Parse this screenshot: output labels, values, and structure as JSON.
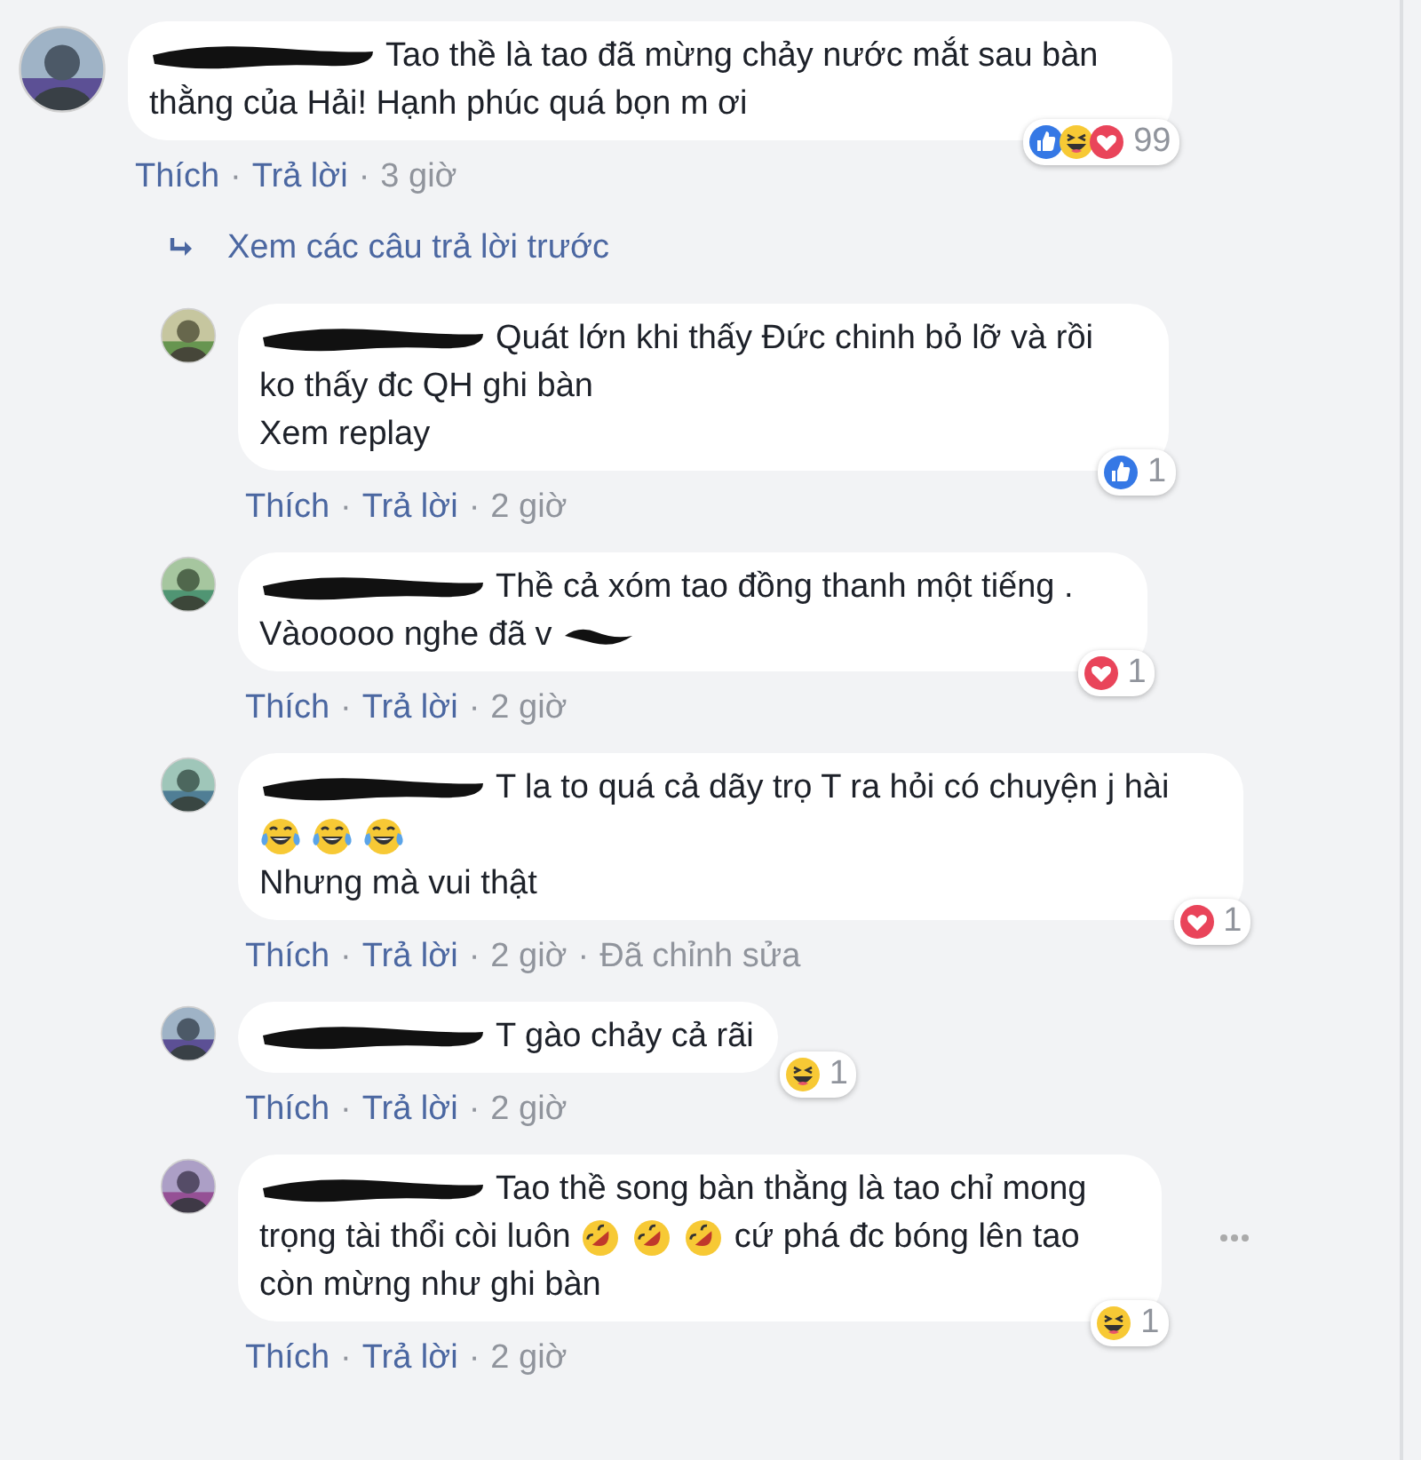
{
  "comment": {
    "lines": [
      [
        {
          "kind": "redaction"
        },
        {
          "kind": "text",
          "text": "Tao thề là tao đã mừng chảy nước mắt sau bàn"
        }
      ],
      [
        {
          "kind": "text",
          "text": "thằng của Hải! Hạnh phúc quá bọn m ơi"
        }
      ]
    ],
    "meta": [
      {
        "kind": "link",
        "text": "Thích"
      },
      {
        "kind": "dot",
        "text": "·"
      },
      {
        "kind": "link",
        "text": "Trả lời"
      },
      {
        "kind": "dot",
        "text": "·"
      },
      {
        "kind": "time",
        "text": "3 giờ"
      }
    ],
    "reactions": {
      "icons": [
        {
          "kind": "like"
        },
        {
          "kind": "haha"
        },
        {
          "kind": "love"
        }
      ],
      "count": "99"
    }
  },
  "view_previous": {
    "text": "Xem các câu trả lời trước"
  },
  "replies": [
    {
      "lines": [
        [
          {
            "kind": "redaction"
          },
          {
            "kind": "text",
            "text": "Quát lớn khi thấy Đức chinh bỏ lỡ và rồi"
          }
        ],
        [
          {
            "kind": "text",
            "text": "ko thấy đc QH ghi bàn"
          }
        ],
        [
          {
            "kind": "text",
            "text": "Xem replay"
          }
        ]
      ],
      "meta": [
        {
          "kind": "link",
          "text": "Thích"
        },
        {
          "kind": "dot",
          "text": "·"
        },
        {
          "kind": "link",
          "text": "Trả lời"
        },
        {
          "kind": "dot",
          "text": "·"
        },
        {
          "kind": "time",
          "text": "2 giờ"
        }
      ],
      "reactions": {
        "icons": [
          {
            "kind": "like"
          }
        ],
        "count": "1"
      }
    },
    {
      "lines": [
        [
          {
            "kind": "redaction"
          },
          {
            "kind": "text",
            "text": "Thề cả xóm tao đồng thanh một tiếng ."
          }
        ],
        [
          {
            "kind": "text",
            "text": "Vàooooo nghe đã v"
          },
          {
            "kind": "redaction-short"
          }
        ]
      ],
      "meta": [
        {
          "kind": "link",
          "text": "Thích"
        },
        {
          "kind": "dot",
          "text": "·"
        },
        {
          "kind": "link",
          "text": "Trả lời"
        },
        {
          "kind": "dot",
          "text": "·"
        },
        {
          "kind": "time",
          "text": "2 giờ"
        }
      ],
      "reactions": {
        "icons": [
          {
            "kind": "love"
          }
        ],
        "count": "1"
      }
    },
    {
      "lines": [
        [
          {
            "kind": "redaction"
          },
          {
            "kind": "text",
            "text": "T la to quá cả dãy trọ T ra hỏi có chuyện j hài"
          }
        ],
        [
          {
            "kind": "joy"
          },
          {
            "kind": "joy"
          },
          {
            "kind": "joy"
          }
        ],
        [
          {
            "kind": "text",
            "text": "Nhưng mà vui thật"
          }
        ]
      ],
      "meta": [
        {
          "kind": "link",
          "text": "Thích"
        },
        {
          "kind": "dot",
          "text": "·"
        },
        {
          "kind": "link",
          "text": "Trả lời"
        },
        {
          "kind": "dot",
          "text": "·"
        },
        {
          "kind": "time",
          "text": "2 giờ"
        },
        {
          "kind": "dot",
          "text": "·"
        },
        {
          "kind": "time",
          "text": "Đã chỉnh sửa"
        }
      ],
      "reactions": {
        "icons": [
          {
            "kind": "love"
          }
        ],
        "count": "1"
      }
    },
    {
      "lines": [
        [
          {
            "kind": "redaction"
          },
          {
            "kind": "text",
            "text": "T gào chảy cả rãi"
          }
        ]
      ],
      "meta": [
        {
          "kind": "link",
          "text": "Thích"
        },
        {
          "kind": "dot",
          "text": "·"
        },
        {
          "kind": "link",
          "text": "Trả lời"
        },
        {
          "kind": "dot",
          "text": "·"
        },
        {
          "kind": "time",
          "text": "2 giờ"
        }
      ],
      "reactions": {
        "icons": [
          {
            "kind": "haha"
          }
        ],
        "count": "1"
      }
    },
    {
      "lines": [
        [
          {
            "kind": "redaction"
          },
          {
            "kind": "text",
            "text": "Tao thề song bàn thằng là tao chỉ mong"
          }
        ],
        [
          {
            "kind": "text",
            "text": "trọng tài thổi còi luôn"
          },
          {
            "kind": "rofl"
          },
          {
            "kind": "rofl"
          },
          {
            "kind": "rofl"
          },
          {
            "kind": "text",
            "text": "cứ phá đc bóng lên tao"
          }
        ],
        [
          {
            "kind": "text",
            "text": "còn mừng như ghi bàn"
          }
        ]
      ],
      "meta": [
        {
          "kind": "link",
          "text": "Thích"
        },
        {
          "kind": "dot",
          "text": "·"
        },
        {
          "kind": "link",
          "text": "Trả lời"
        },
        {
          "kind": "dot",
          "text": "·"
        },
        {
          "kind": "time",
          "text": "2 giờ"
        }
      ],
      "reactions": {
        "icons": [
          {
            "kind": "haha"
          }
        ],
        "count": "1"
      },
      "more_options": true
    }
  ]
}
